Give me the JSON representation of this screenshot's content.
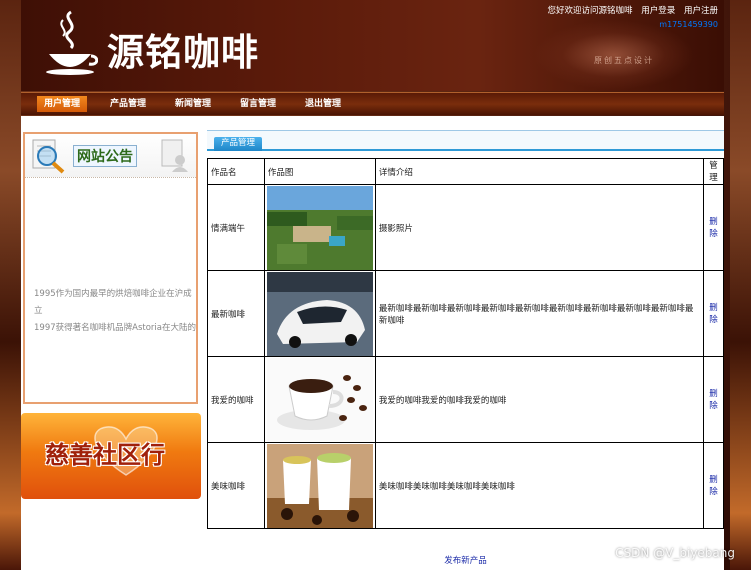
{
  "header": {
    "logo_text": "源铭咖啡",
    "welcome": "您好欢迎访问源铭咖啡",
    "login_label": "用户登录",
    "register_label": "用户注册",
    "username": "m1751459390",
    "ripple_text": "原创五点设计"
  },
  "nav": {
    "items": [
      {
        "label": "用户管理",
        "active": true
      },
      {
        "label": "产品管理",
        "active": false
      },
      {
        "label": "新闻管理",
        "active": false
      },
      {
        "label": "留言管理",
        "active": false
      },
      {
        "label": "退出管理",
        "active": false
      }
    ]
  },
  "sidebar": {
    "notice_title": "网站公告",
    "notice_lines": [
      "1995作为国内最早的烘焙咖啡企业在沪成立",
      "1997获得著名咖啡机品牌Astoria在大陆的"
    ],
    "charity_text": "慈善社区行"
  },
  "main": {
    "tab_label": "产品管理",
    "columns": {
      "name": "作品名",
      "image": "作品图",
      "detail": "详情介绍",
      "manage": "管理"
    },
    "rows": [
      {
        "name": "情满端午",
        "detail": "摄影照片",
        "action": "删除",
        "image": "aerial-photo"
      },
      {
        "name": "最新咖啡",
        "detail": "最新咖啡最新咖啡最新咖啡最新咖啡最新咖啡最新咖啡最新咖啡最新咖啡最新咖啡最新咖啡",
        "action": "删除",
        "image": "white-car-photo"
      },
      {
        "name": "我爱的咖啡",
        "detail": "我爱的咖啡我爱的咖啡我爱的咖啡",
        "action": "删除",
        "image": "coffee-cup-photo"
      },
      {
        "name": "美味咖啡",
        "detail": "美味咖啡美味咖啡美味咖啡美味咖啡",
        "action": "删除",
        "image": "latte-cups-photo"
      }
    ],
    "publish_label": "发布新产品"
  },
  "watermark": "CSDN @V_biyebang",
  "colors": {
    "brand_dark": "#4a1a0c",
    "nav_active": "#e8700f",
    "tab_blue": "#2e9ad6",
    "link_blue": "#1a2aa8"
  }
}
